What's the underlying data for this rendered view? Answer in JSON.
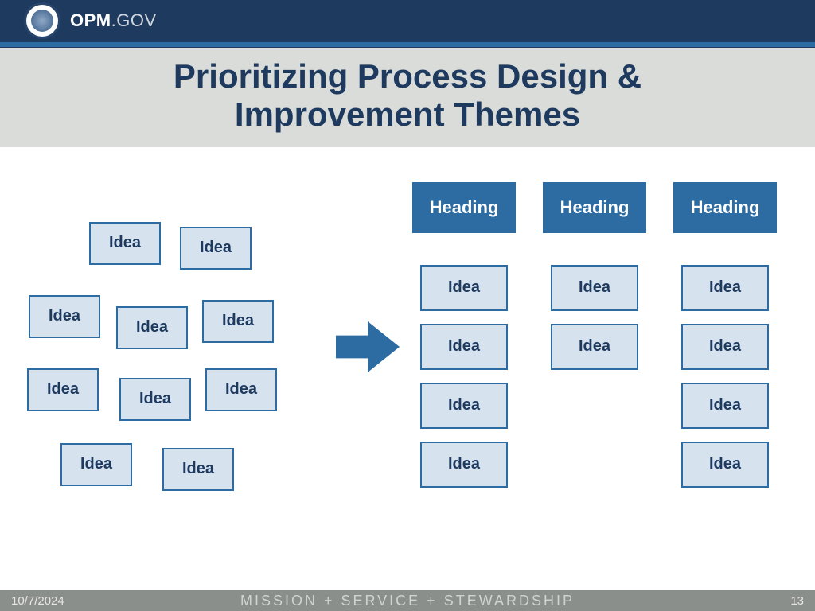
{
  "header": {
    "brand_bold": "OPM",
    "brand_light": ".GOV"
  },
  "title_line1": "Prioritizing Process Design &",
  "title_line2": "Improvement Themes",
  "left_ideas": {
    "i0": "Idea",
    "i1": "Idea",
    "i2": "Idea",
    "i3": "Idea",
    "i4": "Idea",
    "i5": "Idea",
    "i6": "Idea",
    "i7": "Idea",
    "i8": "Idea",
    "i9": "Idea"
  },
  "columns": [
    {
      "heading": "Heading",
      "items": [
        "Idea",
        "Idea",
        "Idea",
        "Idea"
      ]
    },
    {
      "heading": "Heading",
      "items": [
        "Idea",
        "Idea"
      ]
    },
    {
      "heading": "Heading",
      "items": [
        "Idea",
        "Idea",
        "Idea",
        "Idea"
      ]
    }
  ],
  "footer": {
    "date": "10/7/2024",
    "motto": "MISSION  +  SERVICE  +  STEWARDSHIP",
    "page": "13"
  },
  "colors": {
    "navy": "#1f3a5f",
    "blue": "#2d6ca2",
    "lightblue": "#d6e3ef",
    "band": "#d9dcd9",
    "footer": "#8b8f8b"
  }
}
